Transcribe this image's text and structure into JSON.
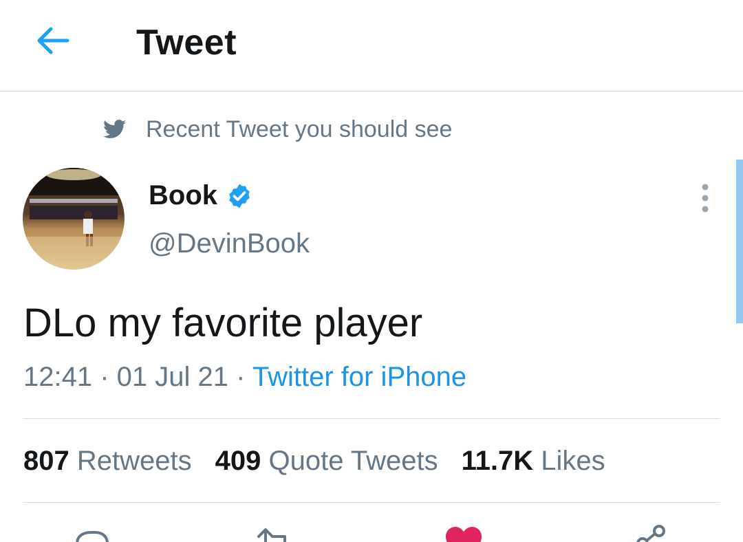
{
  "header": {
    "title": "Tweet",
    "back_icon": "back-arrow-icon"
  },
  "context": {
    "icon": "twitter-bird-icon",
    "text": "Recent Tweet you should see"
  },
  "author": {
    "name": "Book",
    "handle": "@DevinBook",
    "verified": true
  },
  "tweet": {
    "text": "DLo my favorite player",
    "time": "12:41",
    "date": "01 Jul 21",
    "source": "Twitter for iPhone"
  },
  "stats": [
    {
      "count": "807",
      "label": "Retweets"
    },
    {
      "count": "409",
      "label": "Quote Tweets"
    },
    {
      "count": "11.7K",
      "label": "Likes"
    }
  ],
  "colors": {
    "accent": "#1da1f2",
    "link": "#1b95e0",
    "secondary_text": "#657786",
    "like": "#e0245e"
  },
  "actions": [
    "reply-icon",
    "retweet-icon",
    "like-icon",
    "share-icon"
  ]
}
